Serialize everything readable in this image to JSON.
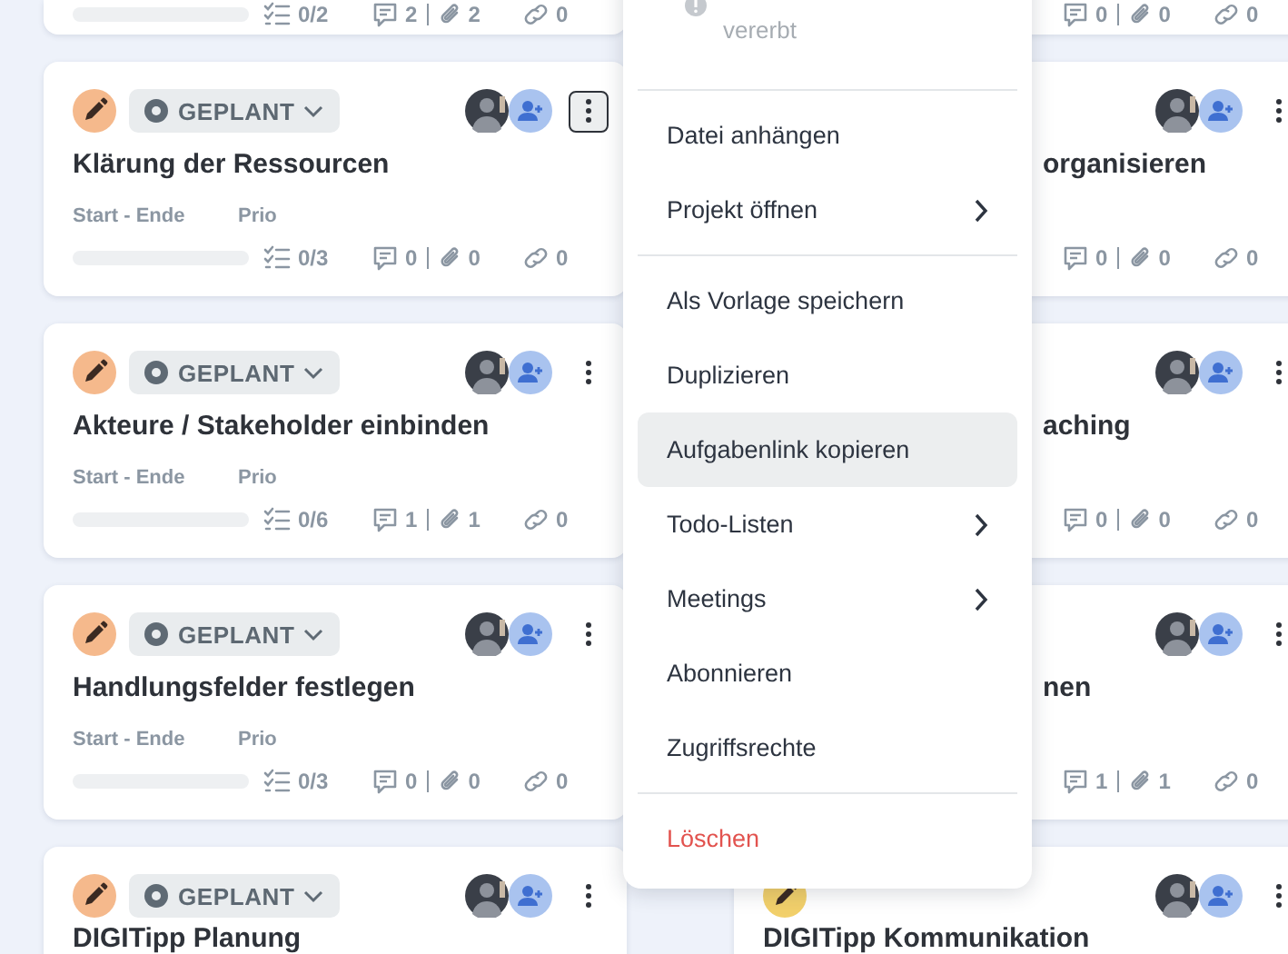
{
  "columns": [
    {
      "cards": [
        {
          "kind": "stats_only",
          "level": 0,
          "checklist": "0/2",
          "comments": "2",
          "attachments": "2",
          "links": "0"
        },
        {
          "kind": "full",
          "color": "#f5b98c",
          "status": "GEPLANT",
          "title": "Klärung der Ressourcen",
          "date_label": "Start - Ende",
          "prio_label": "Prio",
          "level": 0,
          "checklist": "0/3",
          "comments": "0",
          "attachments": "0",
          "links": "0",
          "menu_open": true
        },
        {
          "kind": "full",
          "color": "#f5b98c",
          "status": "GEPLANT",
          "title": "Akteure / Stakeholder einbinden",
          "date_label": "Start - Ende",
          "prio_label": "Prio",
          "level": 0,
          "checklist": "0/6",
          "comments": "1",
          "attachments": "1",
          "links": "0",
          "menu_open": false
        },
        {
          "kind": "full",
          "color": "#f5b98c",
          "status": "GEPLANT",
          "title": "Handlungsfelder festlegen",
          "date_label": "Start - Ende",
          "prio_label": "Prio",
          "level": 0,
          "checklist": "0/3",
          "comments": "0",
          "attachments": "0",
          "links": "0",
          "menu_open": false
        },
        {
          "kind": "bottom",
          "color": "#f5b98c",
          "status": "GEPLANT",
          "title": "DIGITipp Planung",
          "menu_open": false
        }
      ]
    },
    {
      "cards": [
        {
          "kind": "stats_only",
          "comments": "0",
          "attachments": "0",
          "links": "0"
        },
        {
          "kind": "covered",
          "title": "organisieren",
          "comments": "0",
          "attachments": "0",
          "links": "0",
          "menu_open": false
        },
        {
          "kind": "covered",
          "title": "aching",
          "comments": "0",
          "attachments": "0",
          "links": "0",
          "menu_open": false
        },
        {
          "kind": "covered",
          "title": "nen",
          "comments": "1",
          "attachments": "1",
          "links": "0",
          "menu_open": false
        },
        {
          "kind": "bottom",
          "color": "#f2d06b",
          "title": "DIGITipp Kommunikation",
          "menu_open": false
        }
      ]
    }
  ],
  "menu": {
    "items": [
      {
        "kind": "note",
        "label": "vererbt"
      },
      {
        "kind": "divider"
      },
      {
        "kind": "item",
        "label": "Datei anhängen",
        "submenu": false,
        "highlighted": false
      },
      {
        "kind": "item",
        "label": "Projekt öffnen",
        "submenu": true,
        "highlighted": false
      },
      {
        "kind": "divider"
      },
      {
        "kind": "item",
        "label": "Als Vorlage speichern",
        "submenu": false,
        "highlighted": false
      },
      {
        "kind": "item",
        "label": "Duplizieren",
        "submenu": false,
        "highlighted": false
      },
      {
        "kind": "item",
        "label": "Aufgabenlink kopieren",
        "submenu": false,
        "highlighted": true
      },
      {
        "kind": "item",
        "label": "Todo-Listen",
        "submenu": true,
        "highlighted": false
      },
      {
        "kind": "item",
        "label": "Meetings",
        "submenu": true,
        "highlighted": false
      },
      {
        "kind": "item",
        "label": "Abonnieren",
        "submenu": false,
        "highlighted": false
      },
      {
        "kind": "item",
        "label": "Zugriffsrechte",
        "submenu": false,
        "highlighted": false
      },
      {
        "kind": "divider"
      },
      {
        "kind": "danger",
        "label": "Löschen"
      }
    ]
  }
}
